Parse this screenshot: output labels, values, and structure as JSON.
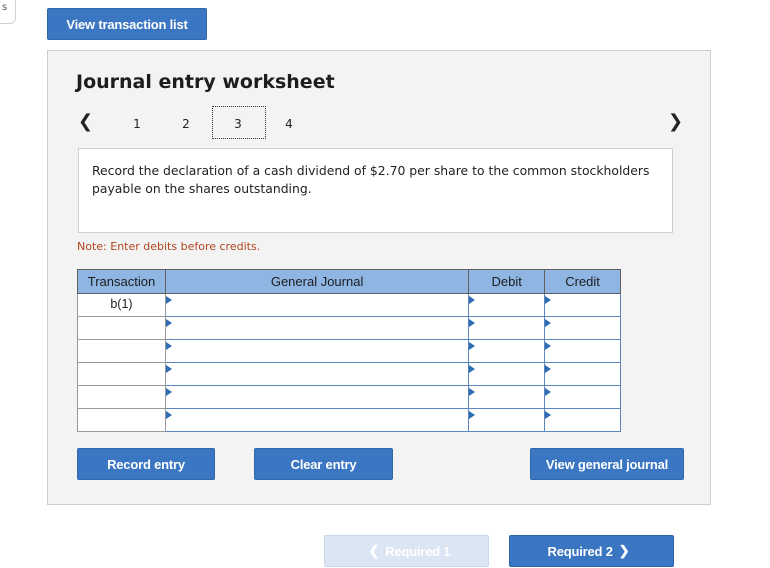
{
  "corner": {
    "text": "s"
  },
  "header": {
    "view_list_label": "View transaction list"
  },
  "worksheet": {
    "title": "Journal entry worksheet",
    "nav": {
      "prev_icon": "chevron-left",
      "next_icon": "chevron-right",
      "steps": [
        "1",
        "2",
        "3",
        "4"
      ],
      "active_step": "3"
    },
    "question": "Record the declaration of a cash dividend of $2.70 per share to the common stockholders payable on the shares outstanding.",
    "note": "Note: Enter debits before credits.",
    "table": {
      "headers": [
        "Transaction",
        "General Journal",
        "Debit",
        "Credit"
      ],
      "rows": [
        {
          "transaction": "b(1)",
          "account": "",
          "debit": "",
          "credit": ""
        },
        {
          "transaction": "",
          "account": "",
          "debit": "",
          "credit": ""
        },
        {
          "transaction": "",
          "account": "",
          "debit": "",
          "credit": ""
        },
        {
          "transaction": "",
          "account": "",
          "debit": "",
          "credit": ""
        },
        {
          "transaction": "",
          "account": "",
          "debit": "",
          "credit": ""
        },
        {
          "transaction": "",
          "account": "",
          "debit": "",
          "credit": ""
        }
      ]
    },
    "buttons": {
      "record": "Record entry",
      "clear": "Clear entry",
      "view_general_journal": "View general journal"
    }
  },
  "footer": {
    "required1_label": "Required 1",
    "required2_label": "Required 2",
    "required1_enabled": false
  },
  "colors": {
    "accent": "#3a76c1",
    "header_fill": "#8fb6e3",
    "note": "#b0451f",
    "disabled": "#dbe5f4"
  }
}
